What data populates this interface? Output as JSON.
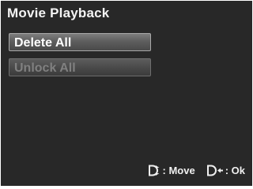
{
  "screen": {
    "title": "Movie Playback"
  },
  "menu": {
    "items": [
      {
        "label": "Delete All",
        "state": "selected"
      },
      {
        "label": "Unlock All",
        "state": "disabled"
      }
    ]
  },
  "hints": {
    "move": {
      "icon": "dpad-up-down-icon",
      "label": ": Move"
    },
    "ok": {
      "icon": "dpad-right-arrow-icon",
      "label": ": Ok"
    }
  },
  "colors": {
    "background": "#282828",
    "text": "#ffffff",
    "disabled_text": "#808080"
  }
}
